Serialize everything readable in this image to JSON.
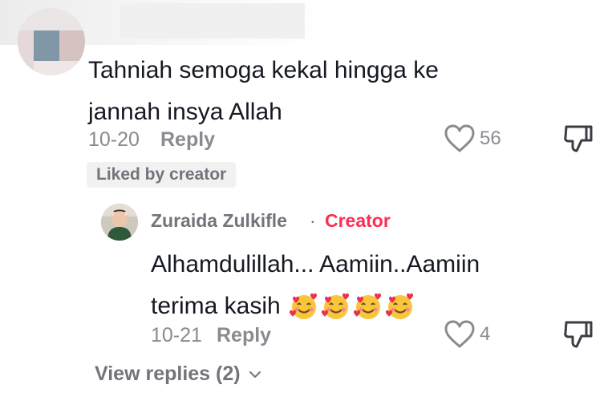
{
  "comment": {
    "text_line1": "Tahniah semoga kekal hingga ke",
    "text_line2": "jannah insya Allah",
    "date": "10-20",
    "reply_label": "Reply",
    "like_count": "56",
    "liked_by_creator": "Liked by creator"
  },
  "reply": {
    "author": "Zuraida Zulkifle",
    "separator": "·",
    "creator_badge": "Creator",
    "text_line1": "Alhamdulillah... Aamiin..Aamiin",
    "text_line2": "terima kasih",
    "emojis": [
      "smiling-face-with-hearts",
      "smiling-face-with-hearts",
      "smiling-face-with-hearts",
      "smiling-face-with-hearts"
    ],
    "date": "10-21",
    "reply_label": "Reply",
    "like_count": "4"
  },
  "view_replies": "View replies (2)",
  "colors": {
    "text": "#161823",
    "secondary": "#8a8b91",
    "creator": "#fe2c55",
    "badge_bg": "#f1f1f2"
  }
}
